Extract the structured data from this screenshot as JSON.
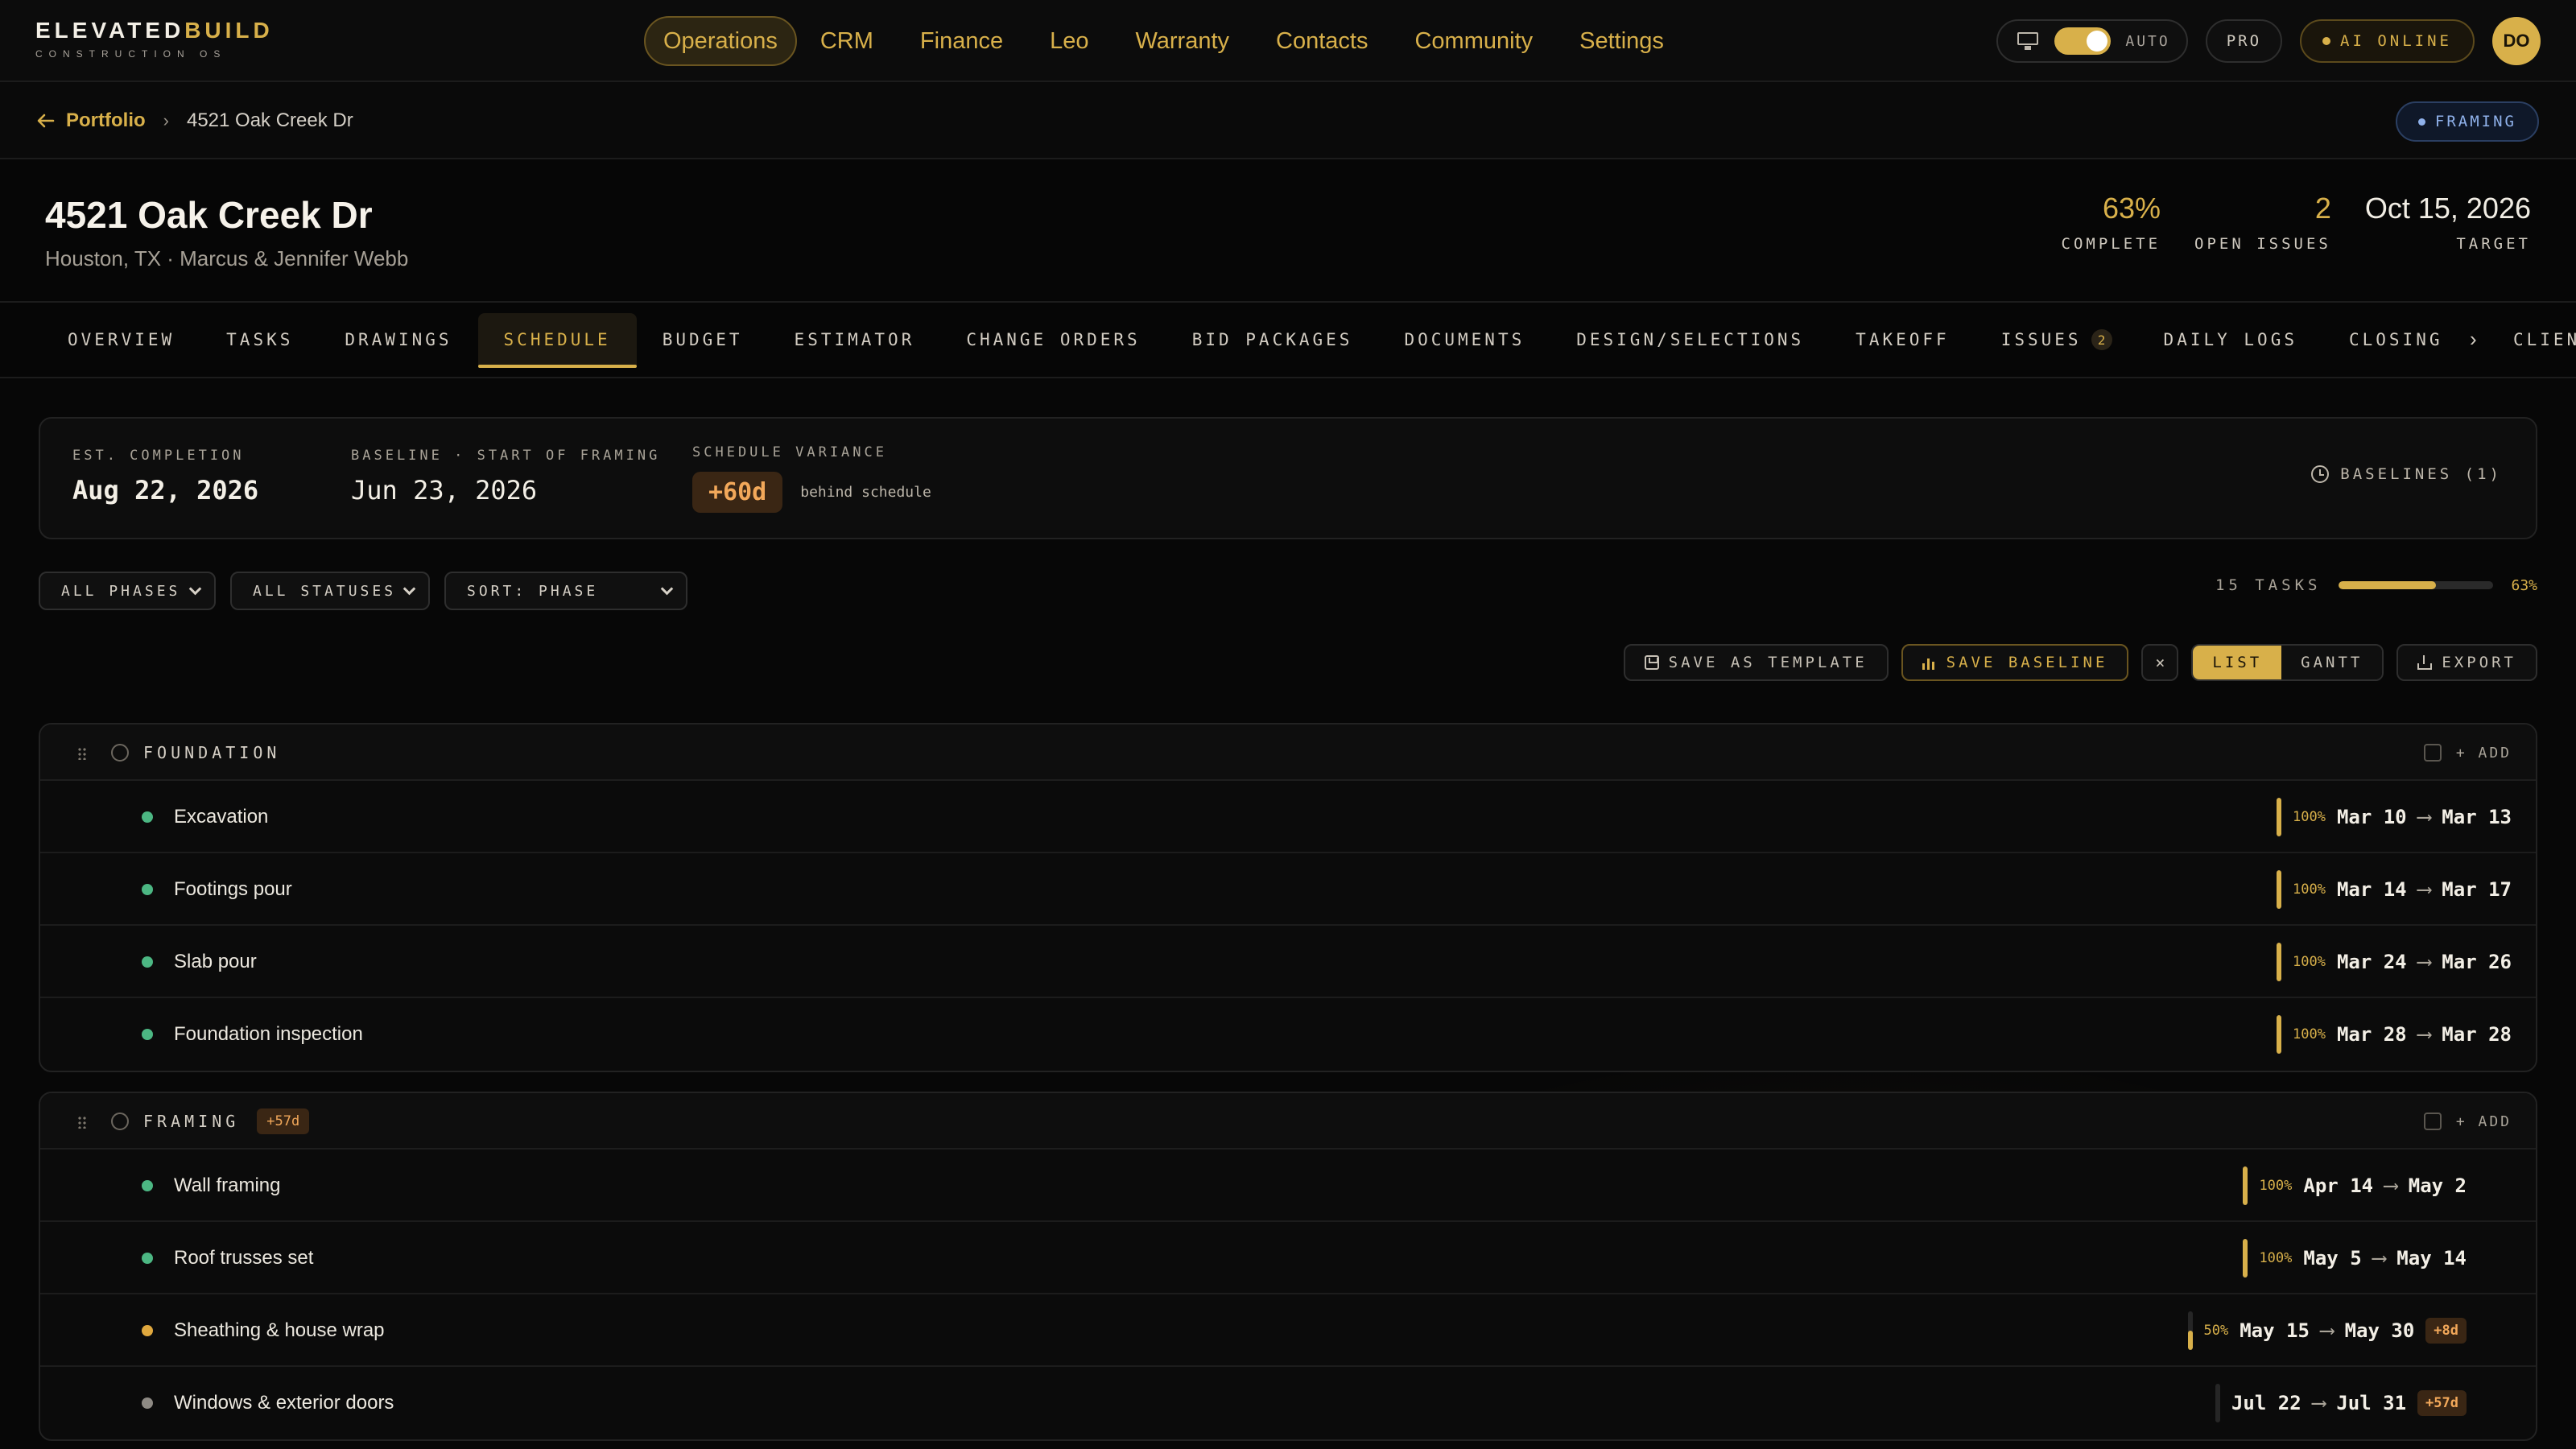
{
  "brand": {
    "name_a": "ELEVATED",
    "name_b": "BUILD",
    "subtitle": "CONSTRUCTION OS"
  },
  "nav": {
    "items": [
      {
        "label": "Operations",
        "active": true
      },
      {
        "label": "CRM"
      },
      {
        "label": "Finance"
      },
      {
        "label": "Leo"
      },
      {
        "label": "Warranty"
      },
      {
        "label": "Contacts"
      },
      {
        "label": "Community"
      },
      {
        "label": "Settings"
      }
    ],
    "auto_label": "AUTO",
    "plan_label": "PRO",
    "ai_label": "AI ONLINE",
    "avatar_initials": "DO"
  },
  "breadcrumb": {
    "back_label": "Portfolio",
    "separator": "›",
    "current": "4521 Oak Creek Dr",
    "stage": "FRAMING"
  },
  "project": {
    "title": "4521 Oak Creek Dr",
    "subtitle": "Houston, TX · Marcus & Jennifer Webb",
    "stats": [
      {
        "value": "63%",
        "label": "COMPLETE"
      },
      {
        "value": "2",
        "label": "OPEN ISSUES"
      },
      {
        "value": "Oct 15, 2026",
        "label": "TARGET"
      }
    ]
  },
  "tabs": [
    {
      "label": "OVERVIEW"
    },
    {
      "label": "TASKS"
    },
    {
      "label": "DRAWINGS"
    },
    {
      "label": "SCHEDULE",
      "active": true
    },
    {
      "label": "BUDGET"
    },
    {
      "label": "ESTIMATOR"
    },
    {
      "label": "CHANGE ORDERS"
    },
    {
      "label": "BID PACKAGES"
    },
    {
      "label": "DOCUMENTS"
    },
    {
      "label": "DESIGN/SELECTIONS"
    },
    {
      "label": "TAKEOFF"
    },
    {
      "label": "ISSUES",
      "count": "2"
    },
    {
      "label": "DAILY LOGS"
    },
    {
      "label": "CLOSING"
    }
  ],
  "tabs_overflow": {
    "chevron": "›",
    "peek": "CLIEN"
  },
  "summary": {
    "est_label": "EST. COMPLETION",
    "est_value": "Aug 22, 2026",
    "base_label": "BASELINE · START OF FRAMING",
    "base_value": "Jun 23, 2026",
    "var_label": "SCHEDULE VARIANCE",
    "var_value": "+60d",
    "var_note": "behind schedule",
    "baselines": "BASELINES (1)"
  },
  "filters": {
    "phases": "ALL PHASES",
    "statuses": "ALL STATUSES",
    "sort": "SORT: PHASE"
  },
  "progress": {
    "tasks": "15 TASKS",
    "percent": "63%",
    "fraction": 0.63
  },
  "actions": {
    "template": "SAVE AS TEMPLATE",
    "baseline": "SAVE BASELINE",
    "close": "×",
    "list": "LIST",
    "gantt": "GANTT",
    "export": "EXPORT"
  },
  "colors": {
    "accent": "#d8b04a",
    "done": "#4cb783",
    "in_progress": "#e0a83e",
    "pending": "#8e8a84",
    "slip": "#f2a85a"
  },
  "phases": [
    {
      "name": "FOUNDATION",
      "chip": "",
      "add_label": "+ ADD",
      "tasks": [
        {
          "name": "Excavation",
          "status": "done",
          "pct": "100%",
          "fraction": 1.0,
          "start": "Mar 10",
          "end": "Mar 13",
          "slip": ""
        },
        {
          "name": "Footings pour",
          "status": "done",
          "pct": "100%",
          "fraction": 1.0,
          "start": "Mar 14",
          "end": "Mar 17",
          "slip": ""
        },
        {
          "name": "Slab pour",
          "status": "done",
          "pct": "100%",
          "fraction": 1.0,
          "start": "Mar 24",
          "end": "Mar 26",
          "slip": ""
        },
        {
          "name": "Foundation inspection",
          "status": "done",
          "pct": "100%",
          "fraction": 1.0,
          "start": "Mar 28",
          "end": "Mar 28",
          "slip": ""
        }
      ]
    },
    {
      "name": "FRAMING",
      "chip": "+57d",
      "add_label": "+ ADD",
      "tasks": [
        {
          "name": "Wall framing",
          "status": "done",
          "pct": "100%",
          "fraction": 1.0,
          "start": "Apr 14",
          "end": "May 2",
          "slip": ""
        },
        {
          "name": "Roof trusses set",
          "status": "done",
          "pct": "100%",
          "fraction": 1.0,
          "start": "May 5",
          "end": "May 14",
          "slip": ""
        },
        {
          "name": "Sheathing & house wrap",
          "status": "in_progress",
          "pct": "50%",
          "fraction": 0.5,
          "start": "May 15",
          "end": "May 30",
          "slip": "+8d"
        },
        {
          "name": "Windows & exterior doors",
          "status": "pending",
          "pct": "",
          "fraction": 0,
          "start": "Jul 22",
          "end": "Jul 31",
          "slip": "+57d"
        }
      ]
    }
  ]
}
